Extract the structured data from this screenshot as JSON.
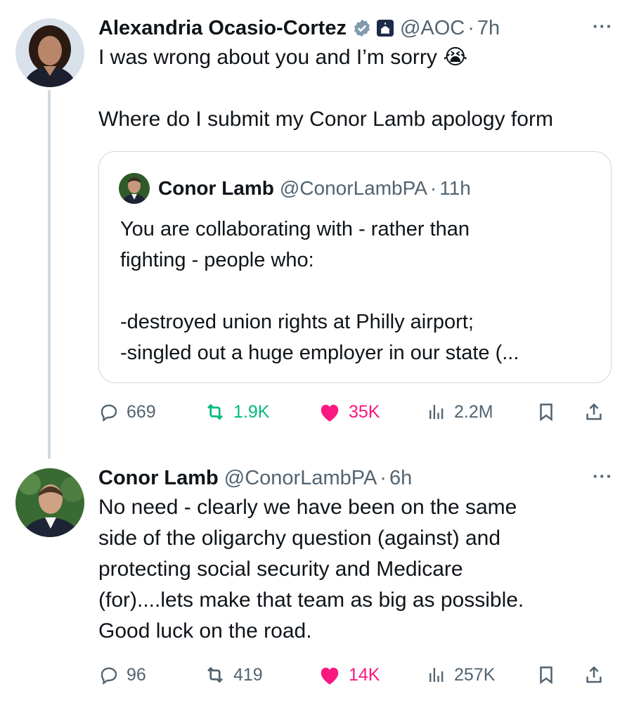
{
  "tweet1": {
    "author_name": "Alexandria Ocasio-Cortez",
    "handle": "@AOC",
    "time_sep": "·",
    "time": "7h",
    "text": "I was wrong about you and I’m sorry",
    "emoji": "😭",
    "text2": "Where do I submit my Conor Lamb apology form",
    "more": "···",
    "quote": {
      "author_name": "Conor Lamb",
      "handle": "@ConorLambPA",
      "time_sep": "·",
      "time": "11h",
      "text": "You are collaborating with - rather than\nfighting - people who:\n\n-destroyed union rights at Philly airport;\n-singled out a huge employer in our state (..."
    },
    "stats": {
      "replies": "669",
      "reposts": "1.9K",
      "likes": "35K",
      "views": "2.2M"
    }
  },
  "tweet2": {
    "author_name": "Conor Lamb",
    "handle": "@ConorLambPA",
    "time_sep": "·",
    "time": "6h",
    "more": "···",
    "text": "No need - clearly we have been on the same\nside of the oligarchy question (against) and\nprotecting social security and Medicare\n(for)....lets make that team as big as possible.\nGood luck on the road.",
    "stats": {
      "replies": "96",
      "reposts": "419",
      "likes": "14K",
      "views": "257K"
    }
  },
  "colors": {
    "text": "#0f1419",
    "secondary": "#536471",
    "repost_active": "#00ba7c",
    "like_active": "#f91880",
    "verified": "#829aab",
    "border": "#cfd9de"
  },
  "icons": [
    "reply-icon",
    "repost-icon",
    "heart-icon",
    "views-icon",
    "bookmark-icon",
    "share-icon",
    "verified-badge-icon",
    "government-badge-icon",
    "more-icon"
  ]
}
